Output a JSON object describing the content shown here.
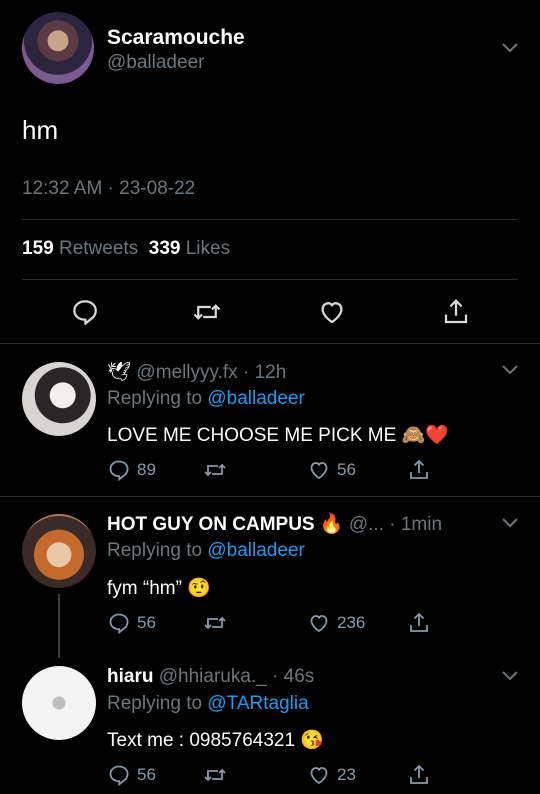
{
  "main": {
    "name": "Scaramouche",
    "handle": "@balladeer",
    "text": "hm",
    "timestamp": "12:32 AM · 23-08-22",
    "retweets": "159",
    "retweets_label": "Retweets",
    "likes": "339",
    "likes_label": "Likes"
  },
  "replies": [
    {
      "handle_time": "@mellyyy.fx · 12h",
      "replying_label": "Replying to",
      "replying_to": "@balladeer",
      "text": "LOVE ME CHOOSE ME PICK ME",
      "reply_count": "89",
      "retweet_count": "",
      "like_count": "56"
    },
    {
      "name": "HOT GUY ON CAMPUS",
      "handle_time": "@...  · 1min",
      "replying_label": "Replying to",
      "replying_to": "@balladeer",
      "text": "fym “hm”",
      "reply_count": "56",
      "retweet_count": "",
      "like_count": "236"
    },
    {
      "name": "hiaru",
      "handle_time": "@hhiaruka._ · 46s",
      "replying_label": "Replying to",
      "replying_to": "@TARtaglia",
      "text": "Text me : 0985764321",
      "reply_count": "56",
      "retweet_count": "",
      "like_count": "23"
    }
  ],
  "colors": {
    "background": "#000000",
    "link": "#1d9bf0",
    "muted": "#6e767d",
    "heart_emoji": "#e0245e"
  }
}
